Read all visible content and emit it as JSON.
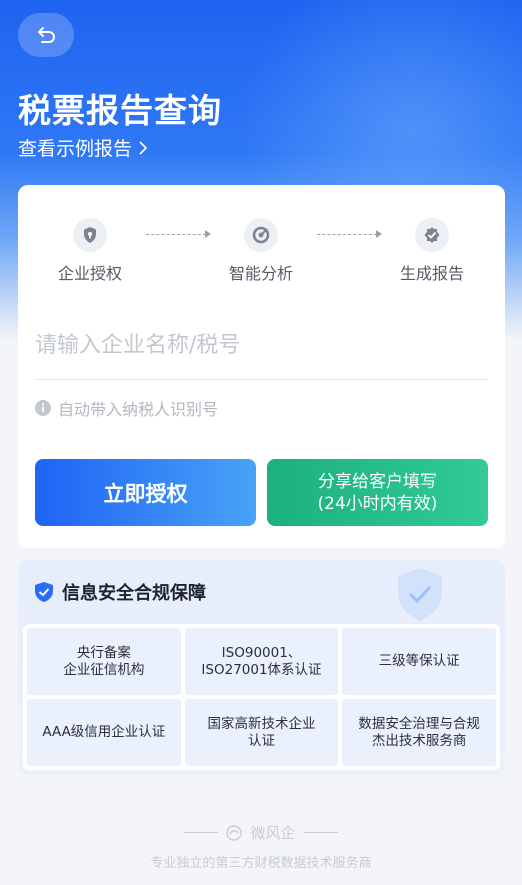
{
  "header": {
    "title": "税票报告查询",
    "sample_link": "查看示例报告"
  },
  "steps": [
    {
      "label": "企业授权",
      "icon": "shield-lock-icon"
    },
    {
      "label": "智能分析",
      "icon": "analysis-icon"
    },
    {
      "label": "生成报告",
      "icon": "badge-check-icon"
    }
  ],
  "form": {
    "placeholder": "请输入企业名称/税号",
    "value": "",
    "hint": "自动带入纳税人识别号"
  },
  "actions": {
    "authorize": "立即授权",
    "share_line1": "分享给客户填写",
    "share_line2": "(24小时内有效)"
  },
  "security": {
    "title": "信息安全合规保障",
    "items": [
      {
        "line1": "央行备案",
        "line2": "企业征信机构"
      },
      {
        "line1": "ISO90001、",
        "line2": "ISO27001体系认证"
      },
      {
        "line1": "三级等保认证",
        "line2": ""
      },
      {
        "line1": "AAA级信用企业认证",
        "line2": ""
      },
      {
        "line1": "国家高新技术企业",
        "line2": "认证"
      },
      {
        "line1": "数据安全治理与合规",
        "line2": "杰出技术服务商"
      }
    ]
  },
  "footer": {
    "brand": "微风企",
    "tagline": "专业独立的第三方财税数据技术服务商"
  },
  "colors": {
    "primary": "#1f63f5",
    "green": "#1cb07d"
  }
}
